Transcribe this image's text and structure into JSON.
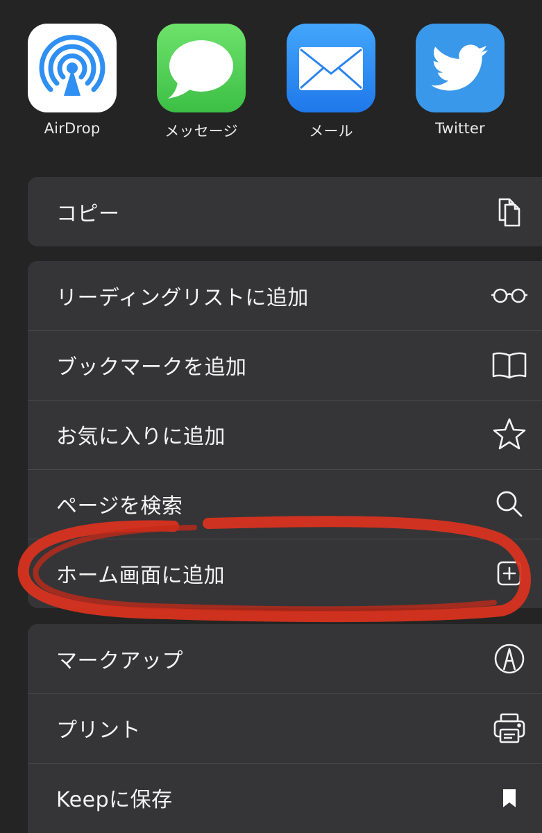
{
  "share_targets": [
    {
      "label": "AirDrop",
      "icon": "airdrop-icon"
    },
    {
      "label": "メッセージ",
      "icon": "messages-icon"
    },
    {
      "label": "メール",
      "icon": "mail-icon"
    },
    {
      "label": "Twitter",
      "icon": "twitter-icon"
    }
  ],
  "actions": {
    "copy": {
      "label": "コピー",
      "icon": "copy-icon"
    },
    "reading_list": {
      "label": "リーディングリストに追加",
      "icon": "glasses-icon"
    },
    "bookmark": {
      "label": "ブックマークを追加",
      "icon": "book-icon"
    },
    "favorites": {
      "label": "お気に入りに追加",
      "icon": "star-icon"
    },
    "find": {
      "label": "ページを検索",
      "icon": "magnifier-icon"
    },
    "home_screen": {
      "label": "ホーム画面に追加",
      "icon": "plus-square-icon"
    },
    "markup": {
      "label": "マークアップ",
      "icon": "markup-pen-icon"
    },
    "print": {
      "label": "プリント",
      "icon": "printer-icon"
    },
    "keep": {
      "label": "Keepに保存",
      "icon": "bookmark-flag-icon"
    }
  },
  "colors": {
    "background": "#242424",
    "row_background": "#353537",
    "airdrop_blue": "#2f8ff2",
    "messages_green": "#43c953",
    "mail_blue": "#2a8df5",
    "twitter_blue": "#3a98ea",
    "highlight_red": "#d8331f"
  }
}
